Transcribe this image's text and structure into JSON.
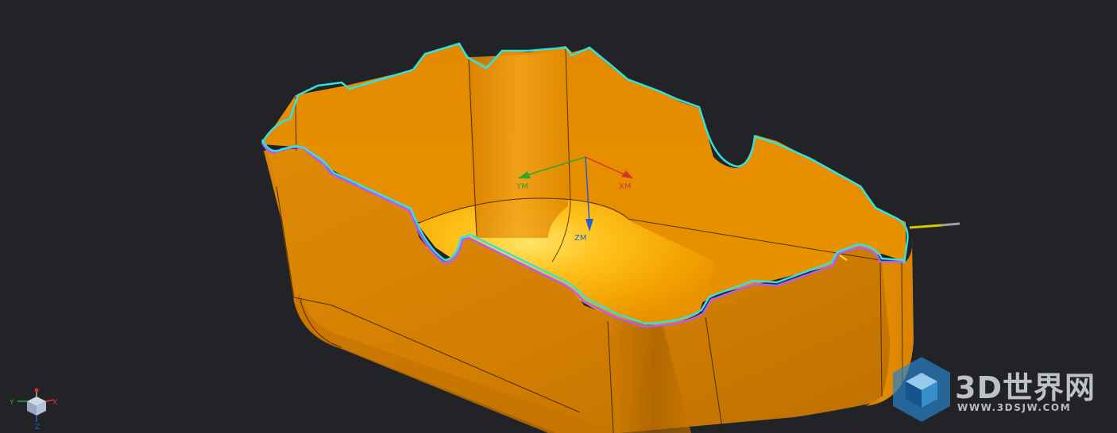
{
  "viewport": {
    "background": "#222327",
    "part_color": "#e68a00",
    "edge_color": "#2fe3e0",
    "inner_edge_color": "#b05cff"
  },
  "csys": {
    "x_label": "XM",
    "y_label": "YM",
    "z_label": "ZM",
    "x_color": "#d8362b",
    "y_color": "#2fa52f",
    "z_color": "#2b5ccf"
  },
  "view_triad": {
    "x_label": "X",
    "y_label": "Y",
    "z_label": "Z"
  },
  "watermark": {
    "title": "3D世界网",
    "url": "WWW.3DSJW.COM",
    "icon": "cube-logo-icon"
  }
}
